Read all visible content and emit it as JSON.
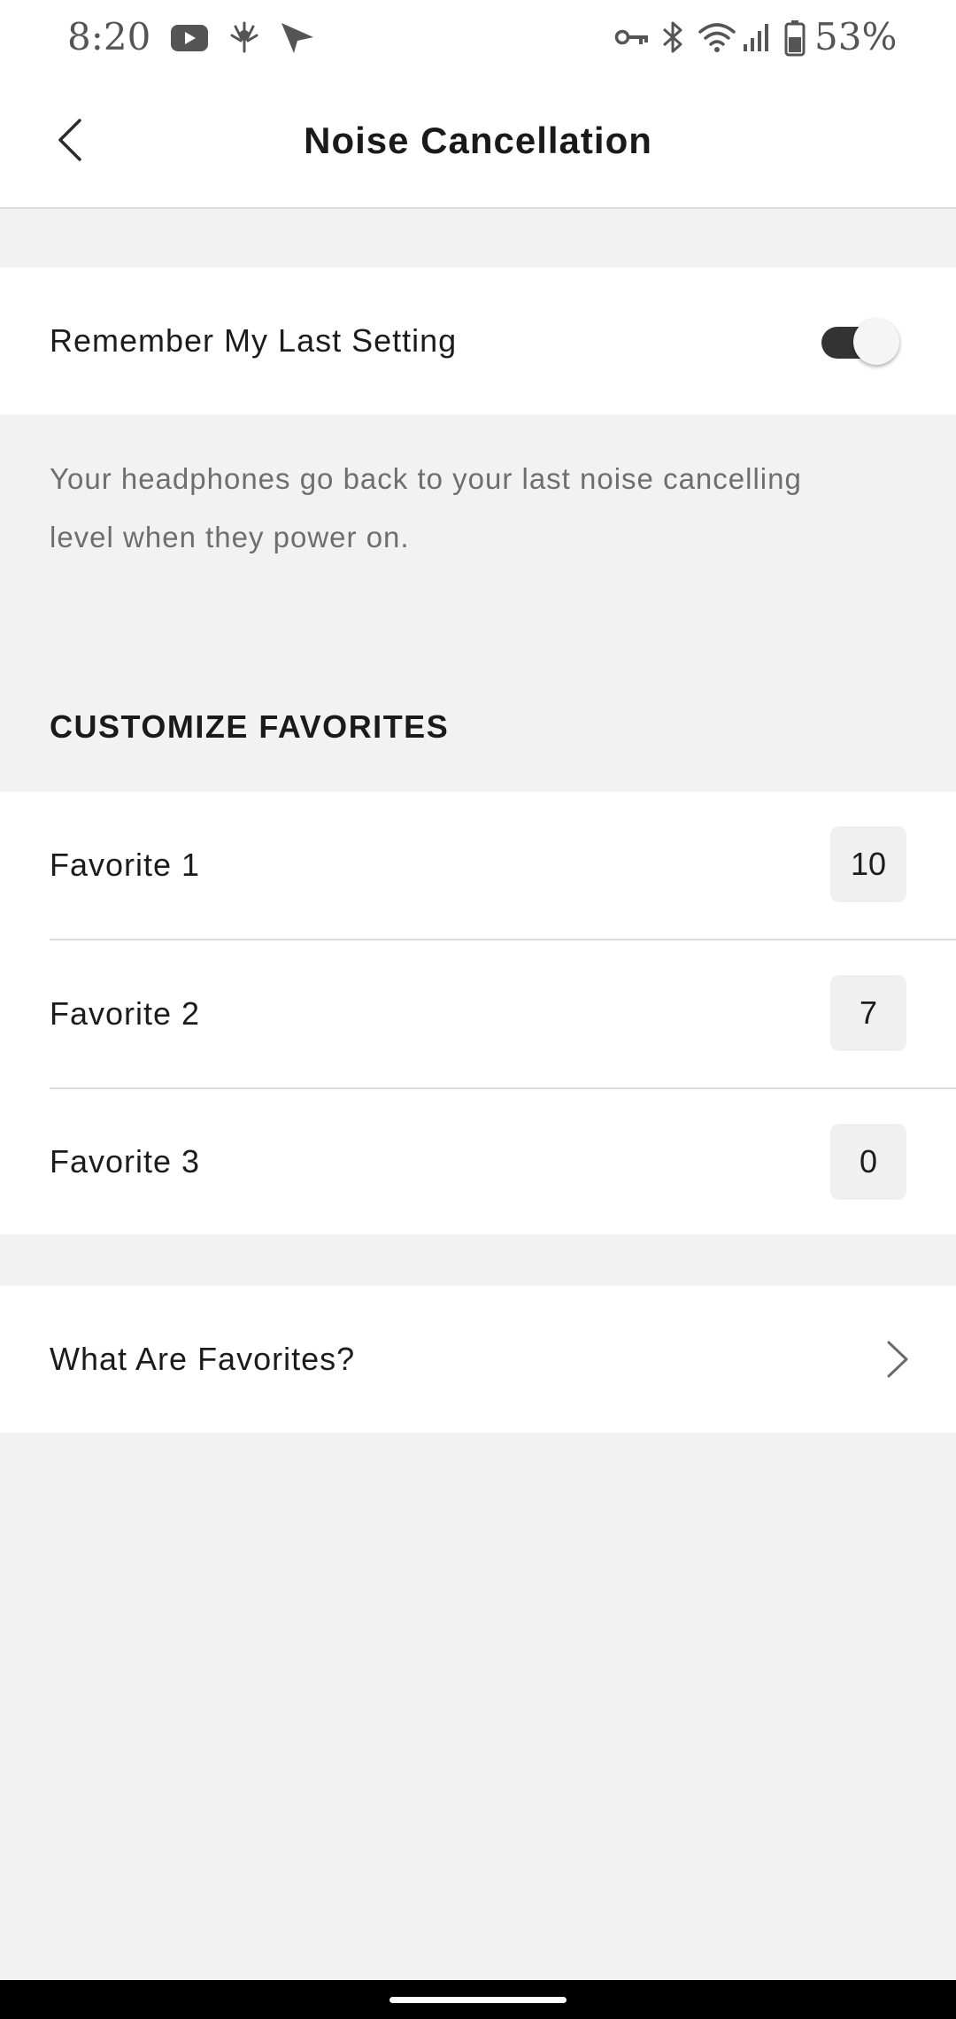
{
  "status_bar": {
    "time": "8:20",
    "battery_percent": "53%",
    "icons": [
      "youtube-icon",
      "app-notification-icon",
      "send-icon",
      "vpn-key-icon",
      "bluetooth-icon",
      "wifi-icon",
      "cell-signal-icon",
      "battery-icon"
    ]
  },
  "header": {
    "title": "Noise Cancellation",
    "back_icon": "chevron-left-icon"
  },
  "remember_setting": {
    "label": "Remember My Last Setting",
    "enabled": true,
    "description": "Your headphones go back to your last noise cancelling level when they power on."
  },
  "favorites": {
    "section_title": "CUSTOMIZE FAVORITES",
    "items": [
      {
        "label": "Favorite 1",
        "value": "10"
      },
      {
        "label": "Favorite 2",
        "value": "7"
      },
      {
        "label": "Favorite 3",
        "value": "0"
      }
    ]
  },
  "info_link": {
    "label": "What Are Favorites?",
    "icon": "chevron-right-icon"
  },
  "colors": {
    "background": "#f2f2f2",
    "surface": "#ffffff",
    "toggle_on": "#333333",
    "text_primary": "#1c1c1c",
    "text_secondary": "#6e6e6e"
  }
}
